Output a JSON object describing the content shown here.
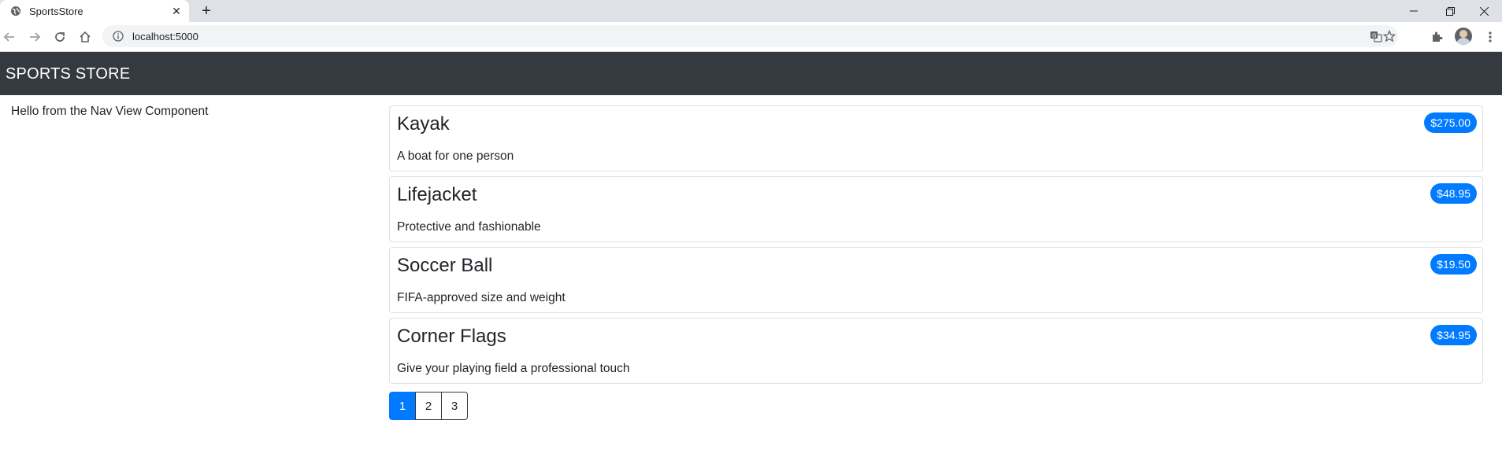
{
  "browser": {
    "tab_title": "SportsStore",
    "url": "localhost:5000"
  },
  "navbar": {
    "brand": "SPORTS STORE"
  },
  "sidebar": {
    "text": "Hello from the Nav View Component"
  },
  "products": [
    {
      "name": "Kayak",
      "description": "A boat for one person",
      "price": "$275.00"
    },
    {
      "name": "Lifejacket",
      "description": "Protective and fashionable",
      "price": "$48.95"
    },
    {
      "name": "Soccer Ball",
      "description": "FIFA-approved size and weight",
      "price": "$19.50"
    },
    {
      "name": "Corner Flags",
      "description": "Give your playing field a professional touch",
      "price": "$34.95"
    }
  ],
  "pagination": {
    "pages": [
      "1",
      "2",
      "3"
    ],
    "current": "1"
  },
  "colors": {
    "navbar_bg": "#343a40",
    "accent": "#007bff",
    "card_border": "#dee2e6"
  }
}
